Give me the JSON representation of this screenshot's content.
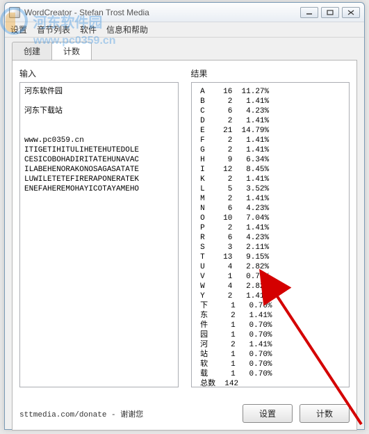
{
  "watermark": {
    "text": "河东软件园",
    "url": "www.pc0359.cn"
  },
  "window": {
    "title": "WordCreator - Stefan Trost Media"
  },
  "menu": {
    "items": [
      "设置",
      "音节列表",
      "软件",
      "信息和帮助"
    ]
  },
  "tabs": {
    "items": [
      "创建",
      "计数"
    ],
    "active": 1
  },
  "panel": {
    "input_label": "输入",
    "result_label": "结果",
    "input_lines": [
      "河东软件园",
      "",
      "河东下载站",
      "",
      "",
      "www.pc0359.cn",
      "ITIGETIHITULIHETEHUTEDOLE",
      "CESICOBOHADIRITATEHUNAVAC",
      "ILABEHENORAKONOSAGASATATE",
      "LUWILETETEFIRERAPONERATEK",
      "ENEFAHEREMOHAYICOTAYAMEHO"
    ],
    "results": [
      {
        "ch": "A",
        "n": 16,
        "pct": "11.27%"
      },
      {
        "ch": "B",
        "n": 2,
        "pct": "1.41%"
      },
      {
        "ch": "C",
        "n": 6,
        "pct": "4.23%"
      },
      {
        "ch": "D",
        "n": 2,
        "pct": "1.41%"
      },
      {
        "ch": "E",
        "n": 21,
        "pct": "14.79%"
      },
      {
        "ch": "F",
        "n": 2,
        "pct": "1.41%"
      },
      {
        "ch": "G",
        "n": 2,
        "pct": "1.41%"
      },
      {
        "ch": "H",
        "n": 9,
        "pct": "6.34%"
      },
      {
        "ch": "I",
        "n": 12,
        "pct": "8.45%"
      },
      {
        "ch": "K",
        "n": 2,
        "pct": "1.41%"
      },
      {
        "ch": "L",
        "n": 5,
        "pct": "3.52%"
      },
      {
        "ch": "M",
        "n": 2,
        "pct": "1.41%"
      },
      {
        "ch": "N",
        "n": 6,
        "pct": "4.23%"
      },
      {
        "ch": "O",
        "n": 10,
        "pct": "7.04%"
      },
      {
        "ch": "P",
        "n": 2,
        "pct": "1.41%"
      },
      {
        "ch": "R",
        "n": 6,
        "pct": "4.23%"
      },
      {
        "ch": "S",
        "n": 3,
        "pct": "2.11%"
      },
      {
        "ch": "T",
        "n": 13,
        "pct": "9.15%"
      },
      {
        "ch": "U",
        "n": 4,
        "pct": "2.82%"
      },
      {
        "ch": "V",
        "n": 1,
        "pct": "0.70%"
      },
      {
        "ch": "W",
        "n": 4,
        "pct": "2.82%"
      },
      {
        "ch": "Y",
        "n": 2,
        "pct": "1.41%"
      },
      {
        "ch": "下",
        "n": 1,
        "pct": "0.70%"
      },
      {
        "ch": "东",
        "n": 2,
        "pct": "1.41%"
      },
      {
        "ch": "件",
        "n": 1,
        "pct": "0.70%"
      },
      {
        "ch": "园",
        "n": 1,
        "pct": "0.70%"
      },
      {
        "ch": "河",
        "n": 2,
        "pct": "1.41%"
      },
      {
        "ch": "站",
        "n": 1,
        "pct": "0.70%"
      },
      {
        "ch": "软",
        "n": 1,
        "pct": "0.70%"
      },
      {
        "ch": "载",
        "n": 1,
        "pct": "0.70%"
      }
    ],
    "total_label": "总数",
    "total": 142
  },
  "footer": {
    "donate": "sttmedia.com/donate - 谢谢您",
    "settings_label": "设置",
    "count_label": "计数"
  }
}
